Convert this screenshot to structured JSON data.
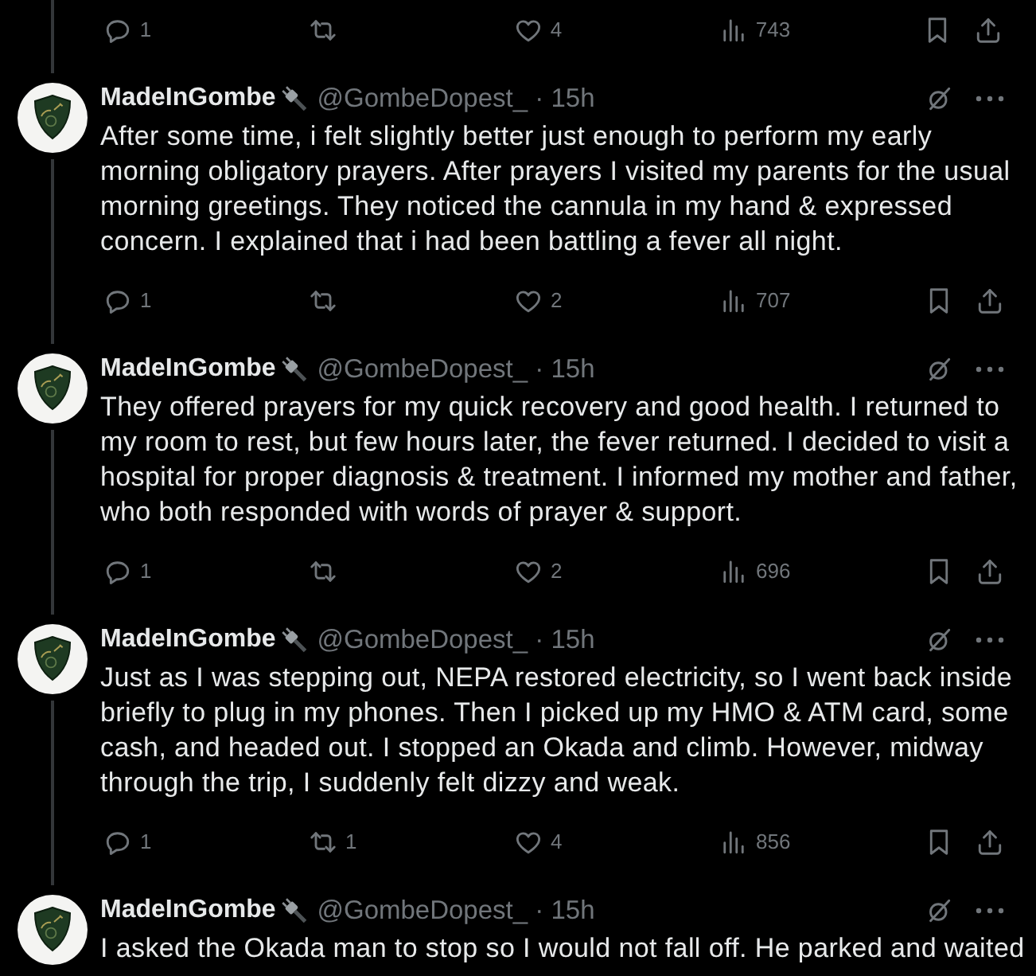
{
  "previous_tweet": {
    "actions": {
      "replies": "1",
      "likes": "4",
      "views": "743"
    }
  },
  "tweets": [
    {
      "name": "MadeInGombe",
      "meta": "@GombeDopest_ · 15h",
      "text": "After some time, i felt slightly better just enough to perform my early morning obligatory prayers. After prayers I visited my parents for the usual morning greetings. They noticed the cannula in my hand & expressed concern. I explained that i had been battling a fever all night.",
      "actions": {
        "replies": "1",
        "likes": "2",
        "views": "707"
      }
    },
    {
      "name": "MadeInGombe",
      "meta": "@GombeDopest_ · 15h",
      "text": "They offered prayers for my quick recovery and good health. I returned to my room to rest, but few hours later, the fever returned. I decided to visit a hospital for proper diagnosis & treatment. I informed my mother and father, who both responded with words of prayer & support.",
      "actions": {
        "replies": "1",
        "likes": "2",
        "views": "696"
      }
    },
    {
      "name": "MadeInGombe",
      "meta": "@GombeDopest_ · 15h",
      "text": "Just as I was stepping out, NEPA restored electricity, so I went back inside briefly to plug in my phones. Then I picked up my HMO & ATM card, some cash, and headed out. I stopped an Okada and climb. However, midway through the trip, I suddenly felt dizzy and weak.",
      "actions": {
        "replies": "1",
        "reposts": "1",
        "likes": "4",
        "views": "856"
      }
    },
    {
      "name": "MadeInGombe",
      "meta": "@GombeDopest_ · 15h",
      "text": "I asked the Okada man to stop so I would not fall off. He parked and waited"
    }
  ]
}
